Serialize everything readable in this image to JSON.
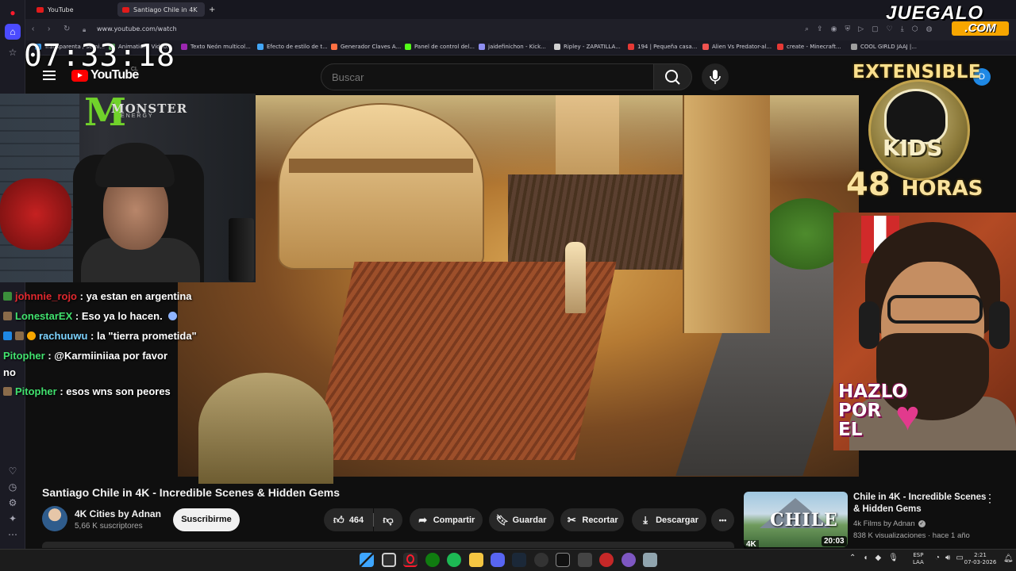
{
  "browser": {
    "tabs": [
      {
        "label": "YouTube"
      },
      {
        "label": "Santiago Chile in 4K"
      }
    ],
    "new_tab": "+",
    "url": "www.youtube.com/watch",
    "bookmarks": [
      {
        "label": "Transparenta / semi...",
        "color": "#3ea6ff"
      },
      {
        "label": "Animations Video...",
        "color": "#66bb6a"
      },
      {
        "label": "Texto Neón multicol...",
        "color": "#9c27b0"
      },
      {
        "label": "Efecto de estilo de t...",
        "color": "#42a5f5"
      },
      {
        "label": "Generador Claves A...",
        "color": "#ff7043"
      },
      {
        "label": "Panel de control del...",
        "color": "#53fc18"
      },
      {
        "label": "jaidefinichon - Kick...",
        "color": "#8e8ef0"
      },
      {
        "label": "Ripley - ZAPATILLA...",
        "color": "#d0d0d0"
      },
      {
        "label": "194 | Pequeña casa...",
        "color": "#e53935"
      },
      {
        "label": "Alien Vs Predator-al...",
        "color": "#ef5350"
      },
      {
        "label": "create - Minecraft...",
        "color": "#e53935"
      },
      {
        "label": "COOL GIRLD JAAJ |...",
        "color": "#9e9e9e"
      }
    ]
  },
  "overlay": {
    "clock": "07:33:18",
    "watermark_top": "JUEGALO",
    "watermark_bottom": ".COM",
    "extensible": "EXTENSIBLE",
    "kids": "KIDS",
    "hours_num": "48",
    "hours_word": "HORAS",
    "hazlo": "HAZLO",
    "por": "POR",
    "el": "EL",
    "monster_title": "MONSTER",
    "monster_sub": "ENERGY"
  },
  "youtube": {
    "logo_text": "YouTube",
    "country": "CL",
    "search_placeholder": "Buscar",
    "profile_initial": "D"
  },
  "chat": [
    {
      "user": "johnnie_rojo",
      "sep": " : ",
      "text": "ya estan en argentina",
      "user_color": "#e0282e"
    },
    {
      "user": "LonestarEX",
      "sep": " : ",
      "text": "Eso ya lo hacen.",
      "user_color": "#41e16e"
    },
    {
      "user": "rachuuwu",
      "sep": " : ",
      "text": "la \"tierra prometida\"",
      "user_color": "#7dd3ff"
    },
    {
      "user": "Pitopher",
      "sep": " : ",
      "text": "@Karmiiniiaa por favor",
      "text2": "no",
      "user_color": "#41e16e"
    },
    {
      "user": "Pitopher",
      "sep": " : ",
      "text": "esos wns son peores",
      "user_color": "#41e16e"
    }
  ],
  "video": {
    "title": "Santiago Chile in 4K - Incredible Scenes & Hidden Gems",
    "channel": "4K Cities by Adnan",
    "subscribers": "5,66 K suscriptores",
    "subscribe": "Suscribirme",
    "likes": "464",
    "share": "Compartir",
    "save": "Guardar",
    "clip": "Recortar",
    "download": "Descargar",
    "more": "•••"
  },
  "recommendation": {
    "thumb_text": "CHILE",
    "thumb_badge": "4K",
    "duration": "20:03",
    "title": "Chile in 4K - Incredible Scenes & Hidden Gems",
    "channel": "4k Films by Adnan",
    "meta": "838 K visualizaciones · hace 1 año"
  },
  "taskbar": {
    "lang_top": "ESP",
    "lang_bottom": "LAA",
    "time": "2:21",
    "date": "07-03-2026"
  }
}
